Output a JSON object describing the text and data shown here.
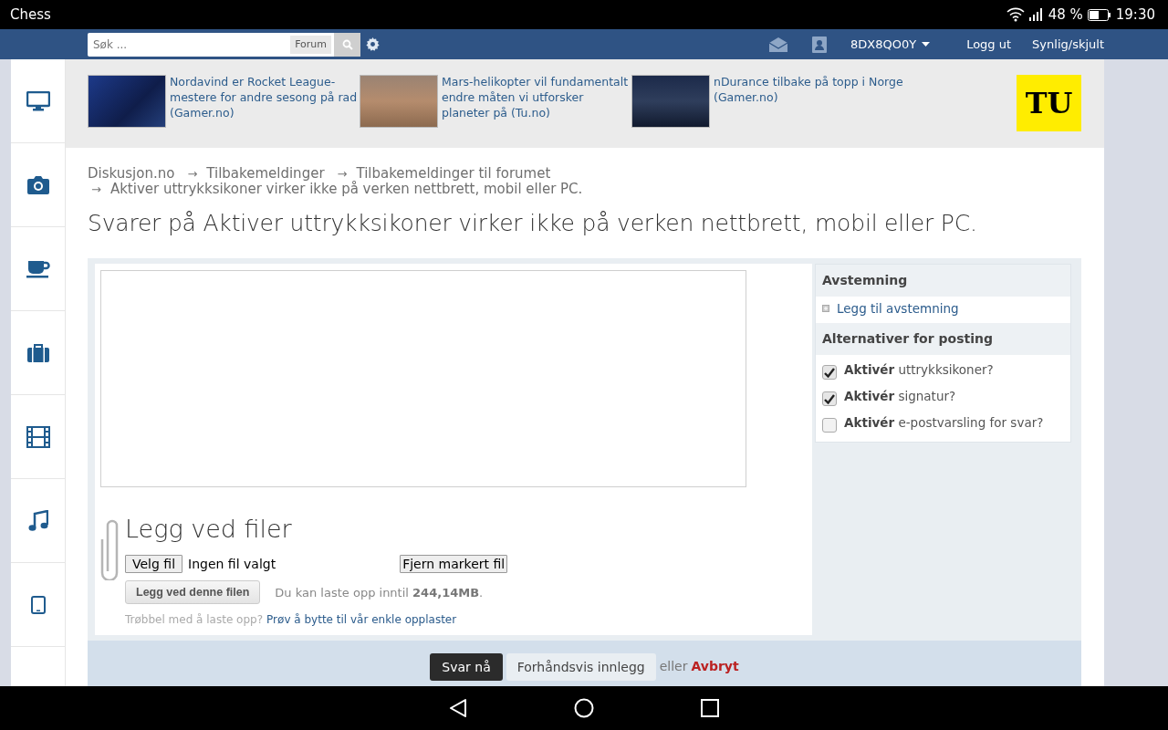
{
  "status_bar": {
    "app": "Chess",
    "battery": "48 %",
    "time": "19:30"
  },
  "top_bar": {
    "search": {
      "placeholder": "Søk ..."
    },
    "scope_button": "Forum",
    "username": "8DX8QO0Y",
    "links": [
      "Logg ut",
      "Synlig/skjult"
    ]
  },
  "news": [
    {
      "text": "Nordavind er Rocket League-mestere for andre sesong på rad (Gamer.no)"
    },
    {
      "text": "Mars-helikopter vil fundamentalt endre måten vi utforsker planeter på (Tu.no)"
    },
    {
      "text": "nDurance tilbake på topp i Norge (Gamer.no)"
    }
  ],
  "ad_logo": "TU",
  "breadcrumb": {
    "separator": "→",
    "items": [
      "Diskusjon.no",
      "Tilbakemeldinger",
      "Tilbakemeldinger til forumet",
      "Aktiver uttrykksikoner virker ikke på verken nettbrett, mobil eller PC."
    ]
  },
  "title": "Svarer på Aktiver uttrykksikoner virker ikke på verken nettbrett, mobil eller PC.",
  "attachments": {
    "heading": "Legg ved filer",
    "choose_button": "Velg fil",
    "no_file": "Ingen fil valgt",
    "remove_button": "Fjern markert fil",
    "upload_button": "Legg ved denne filen",
    "limit_note": "Du kan laste opp inntil **244,14MB**.",
    "trouble": "Trøbbel med å laste opp?",
    "trouble_link": "Prøv å bytte til vår enkle opplaster"
  },
  "poll": {
    "heading": "Avstemning",
    "add_link": "Legg til avstemning"
  },
  "options": {
    "heading": "Alternativer for posting",
    "items": [
      {
        "label": "**Aktivér** uttrykksikoner?",
        "checked": true
      },
      {
        "label": "**Aktivér** signatur?",
        "checked": true
      },
      {
        "label": "**Aktivér** e-postvarsling for svar?",
        "checked": false
      }
    ]
  },
  "actions": {
    "submit": "Svar nå",
    "preview": "Forhåndsvis innlegg",
    "or": "eller",
    "cancel": "Avbryt"
  }
}
